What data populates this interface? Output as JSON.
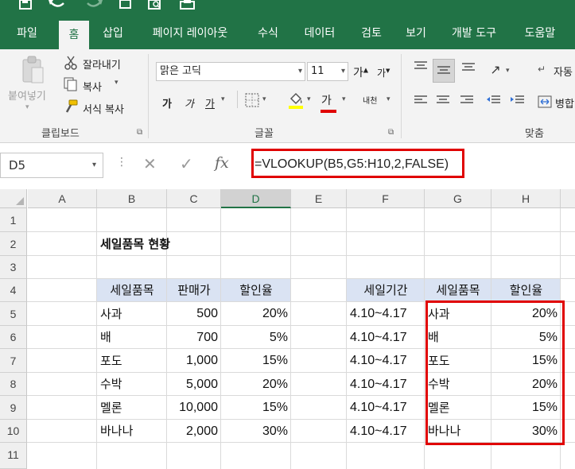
{
  "colors": {
    "accent": "#217346",
    "header_fill": "#dae3f3",
    "highlight": "#e00000"
  },
  "qat_icons": [
    "save-icon",
    "undo-icon",
    "redo-icon",
    "new-file-icon",
    "print-preview-icon",
    "print-icon"
  ],
  "tabs": [
    "파일",
    "홈",
    "삽입",
    "페이지 레이아웃",
    "수식",
    "데이터",
    "검토",
    "보기",
    "개발 도구",
    "도움말"
  ],
  "active_tab": "홈",
  "clipboard": {
    "paste": "붙여넣기",
    "cut": "잘라내기",
    "copy": "복사",
    "format_painter": "서식 복사",
    "group_label": "클립보드"
  },
  "font": {
    "font_name": "맑은 고딕",
    "font_size": "11",
    "grow": "가",
    "shrink": "가",
    "bold": "가",
    "italic": "가",
    "underline": "가",
    "font_color": "가",
    "phonetic": "내천",
    "group_label": "글꼴"
  },
  "alignment": {
    "wrap_label": "자동",
    "merge_label": "병합",
    "group_label": "맞춤"
  },
  "formula_bar": {
    "name_box": "D5",
    "cancel": "✕",
    "enter": "✓",
    "fx": "fx",
    "formula": "=VLOOKUP(B5,G5:H10,2,FALSE)"
  },
  "sheet": {
    "columns": [
      "A",
      "B",
      "C",
      "D",
      "E",
      "F",
      "G",
      "H"
    ],
    "selected_column": "D",
    "rows": [
      "1",
      "2",
      "3",
      "4",
      "5",
      "6",
      "7",
      "8",
      "9",
      "10",
      "11"
    ],
    "title": "세일품목 현황",
    "left_headers": [
      "세일품목",
      "판매가",
      "할인율"
    ],
    "left_table": [
      [
        "사과",
        "500",
        "20%"
      ],
      [
        "배",
        "700",
        "5%"
      ],
      [
        "포도",
        "1,000",
        "15%"
      ],
      [
        "수박",
        "5,000",
        "20%"
      ],
      [
        "멜론",
        "10,000",
        "15%"
      ],
      [
        "바나나",
        "2,000",
        "30%"
      ]
    ],
    "right_headers": [
      "세일기간",
      "세일품목",
      "할인율"
    ],
    "right_table": [
      [
        "4.10~4.17",
        "사과",
        "20%"
      ],
      [
        "4.10~4.17",
        "배",
        "5%"
      ],
      [
        "4.10~4.17",
        "포도",
        "15%"
      ],
      [
        "4.10~4.17",
        "수박",
        "20%"
      ],
      [
        "4.10~4.17",
        "멜론",
        "15%"
      ],
      [
        "4.10~4.17",
        "바나나",
        "30%"
      ]
    ]
  }
}
